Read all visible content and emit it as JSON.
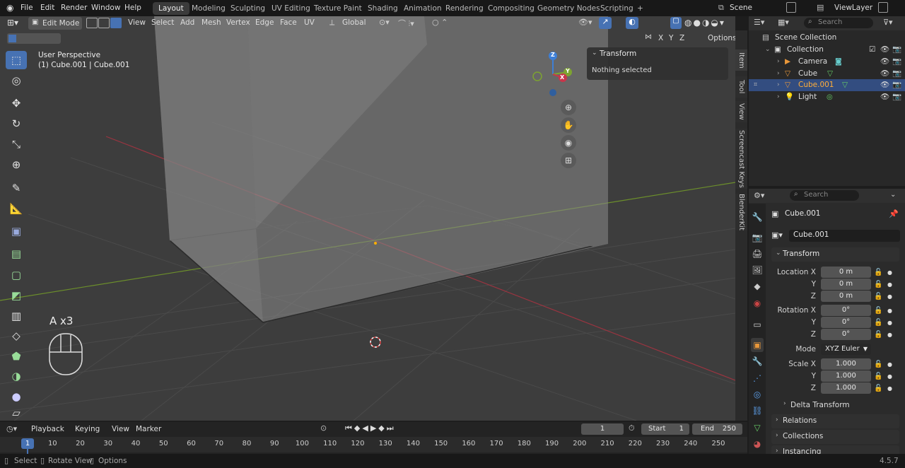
{
  "menu": [
    "File",
    "Edit",
    "Render",
    "Window",
    "Help"
  ],
  "workspaces": [
    "Layout",
    "Modeling",
    "Sculpting",
    "UV Editing",
    "Texture Paint",
    "Shading",
    "Animation",
    "Rendering",
    "Compositing",
    "Geometry Nodes",
    "Scripting"
  ],
  "add_workspace": "+",
  "scene": "Scene",
  "view_layer": "ViewLayer",
  "header": {
    "mode": "Edit Mode",
    "menus": [
      "View",
      "Select",
      "Add",
      "Mesh",
      "Vertex",
      "Edge",
      "Face",
      "UV"
    ],
    "orientation": "Global"
  },
  "overlay": {
    "persp": "User Perspective",
    "object": "(1) Cube.001 | Cube.001",
    "axes": [
      "X",
      "Y",
      "Z"
    ],
    "options": "Options"
  },
  "gizmo": {
    "x": "X",
    "y": "Y",
    "z": "Z"
  },
  "npanel": {
    "title": "Transform",
    "msg": "Nothing selected",
    "tabs": [
      "Item",
      "Tool",
      "View",
      "Screencast Keys",
      "BlenderKit"
    ]
  },
  "screencast": {
    "keys": "A x3"
  },
  "outliner": {
    "search": "Search",
    "scene_collection": "Scene Collection",
    "collection": "Collection",
    "items": [
      "Camera",
      "Cube",
      "Cube.001",
      "Light"
    ]
  },
  "props": {
    "search": "Search",
    "object": "Cube.001",
    "data": "Cube.001",
    "section": "Transform",
    "location_label": "Location X",
    "rotation_label": "Rotation X",
    "mode_label": "Mode",
    "scale_label": "Scale X",
    "y": "Y",
    "z": "Z",
    "location": [
      "0 m",
      "0 m",
      "0 m"
    ],
    "rotation": [
      "0°",
      "0°",
      "0°"
    ],
    "mode": "XYZ Euler",
    "scale": [
      "1.000",
      "1.000",
      "1.000"
    ],
    "subsections": [
      "Delta Transform",
      "Relations",
      "Collections",
      "Instancing"
    ]
  },
  "timeline": {
    "menus": [
      "Playback",
      "Keying",
      "View",
      "Marker"
    ],
    "current": "1",
    "start_label": "Start",
    "start": "1",
    "end_label": "End",
    "end": "250",
    "ticks": [
      "1",
      "10",
      "20",
      "30",
      "40",
      "50",
      "60",
      "70",
      "80",
      "90",
      "100",
      "110",
      "120",
      "130",
      "140",
      "150",
      "160",
      "170",
      "180",
      "190",
      "200",
      "210",
      "220",
      "230",
      "240",
      "250"
    ]
  },
  "status": {
    "select": "Select",
    "rotate": "Rotate View",
    "options": "Options",
    "version": "4.5.7"
  },
  "colors": {
    "accent": "#4772b3",
    "x_axis": "#c8364b",
    "y_axis": "#7da331",
    "z_axis": "#3e7fd6",
    "object_orange": "#e8973a"
  }
}
